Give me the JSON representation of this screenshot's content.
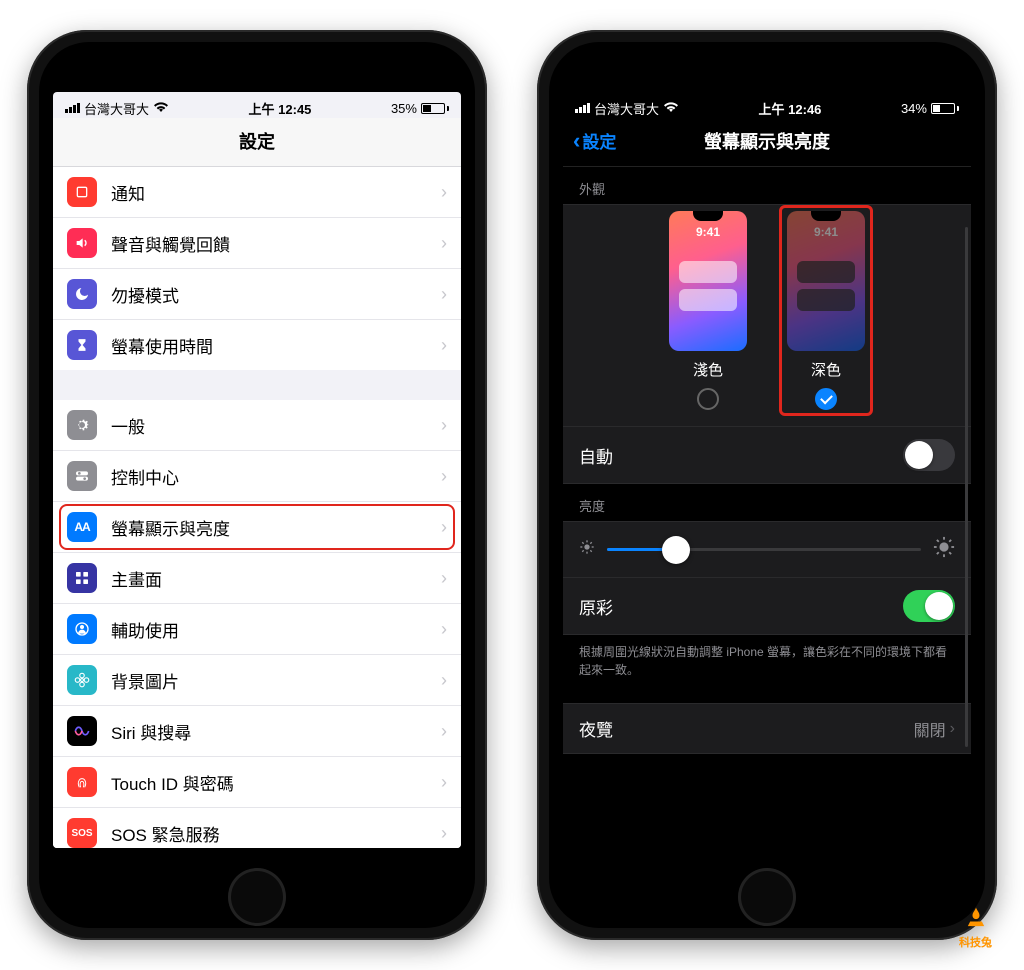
{
  "left": {
    "status": {
      "carrier": "台灣大哥大",
      "time": "上午 12:45",
      "battery_pct": "35%",
      "battery_fill": 35
    },
    "title": "設定",
    "groups": [
      [
        {
          "icon_bg": "#ff3b30",
          "glyph": "square",
          "label": "通知"
        },
        {
          "icon_bg": "#ff2d55",
          "glyph": "sound",
          "label": "聲音與觸覺回饋"
        },
        {
          "icon_bg": "#5856d6",
          "glyph": "moon",
          "label": "勿擾模式"
        },
        {
          "icon_bg": "#5856d6",
          "glyph": "hourglass",
          "label": "螢幕使用時間"
        }
      ],
      [
        {
          "icon_bg": "#8e8e93",
          "glyph": "gear",
          "label": "一般"
        },
        {
          "icon_bg": "#8e8e93",
          "glyph": "toggles",
          "label": "控制中心"
        },
        {
          "icon_bg": "#007aff",
          "glyph": "AA",
          "label": "螢幕顯示與亮度",
          "highlight": true
        },
        {
          "icon_bg": "#3634a3",
          "glyph": "grid",
          "label": "主畫面"
        },
        {
          "icon_bg": "#007aff",
          "glyph": "person",
          "label": "輔助使用"
        },
        {
          "icon_bg": "#28b8c8",
          "glyph": "flower",
          "label": "背景圖片"
        },
        {
          "icon_bg": "#000000",
          "glyph": "siri",
          "label": "Siri 與搜尋"
        },
        {
          "icon_bg": "#ff3b30",
          "glyph": "finger",
          "label": "Touch ID 與密碼"
        },
        {
          "icon_bg": "#ff3b30",
          "glyph": "SOS",
          "label": "SOS 緊急服務"
        }
      ]
    ]
  },
  "right": {
    "status": {
      "carrier": "台灣大哥大",
      "time": "上午 12:46",
      "battery_pct": "34%",
      "battery_fill": 34
    },
    "back_label": "設定",
    "title": "螢幕顯示與亮度",
    "appearance_header": "外觀",
    "light_label": "淺色",
    "dark_label": "深色",
    "mini_time": "9:41",
    "auto_label": "自動",
    "auto_on": false,
    "brightness_header": "亮度",
    "brightness_pct": 22,
    "truetone_label": "原彩",
    "truetone_on": true,
    "truetone_note": "根據周圍光線狀況自動調整 iPhone 螢幕，讓色彩在不同的環境下都看起來一致。",
    "night_label": "夜覽",
    "night_value": "關閉"
  },
  "watermark": "科技兔"
}
